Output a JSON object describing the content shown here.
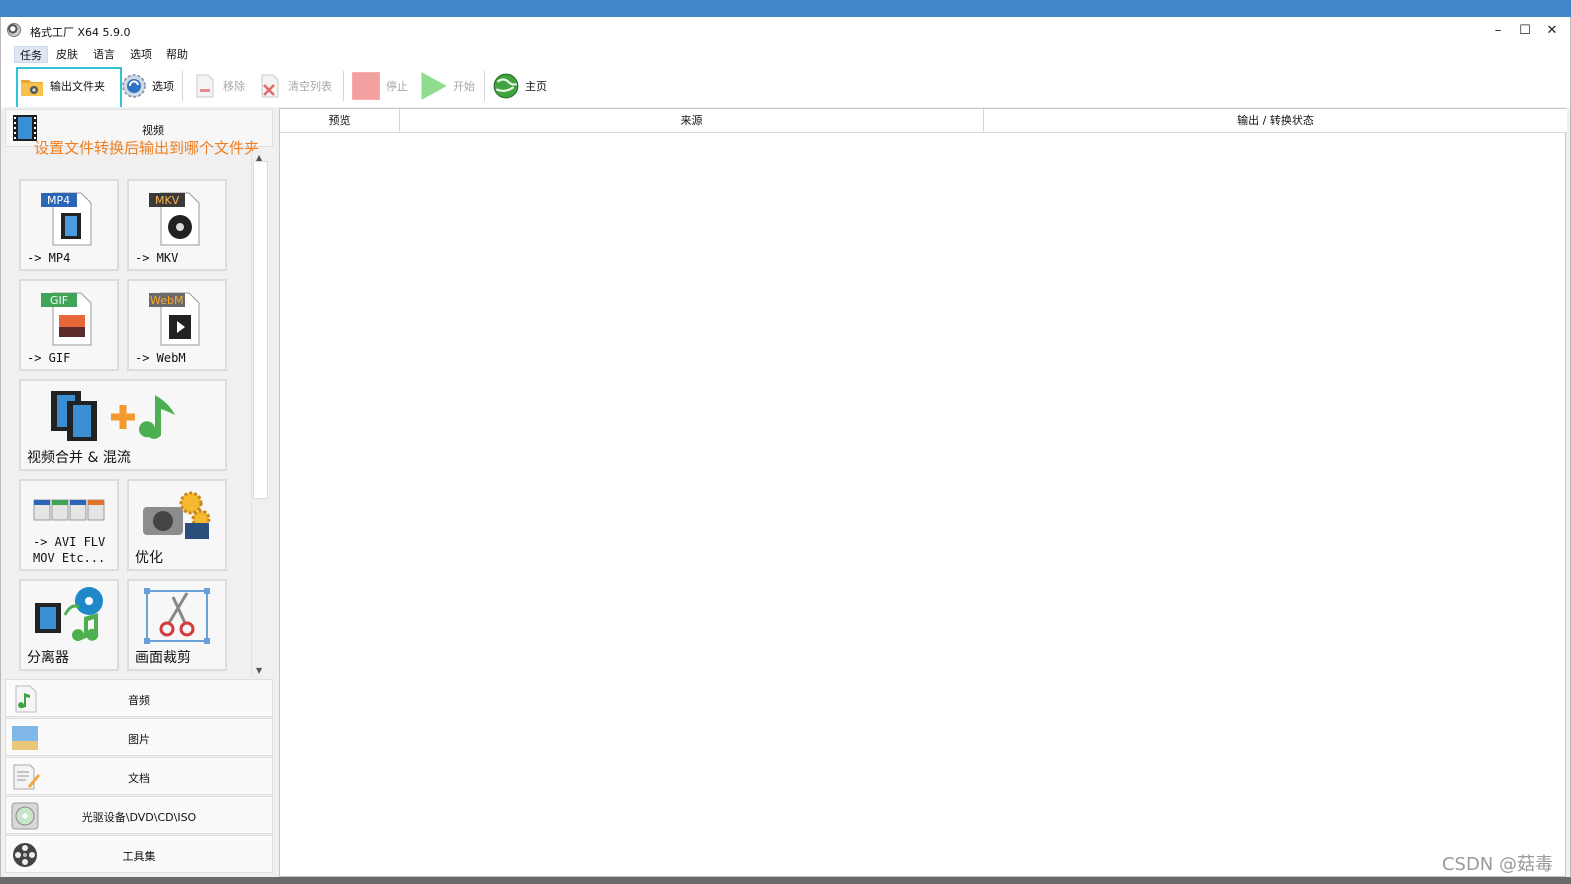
{
  "window": {
    "title": "格式工厂 X64 5.9.0"
  },
  "menu": [
    "任务",
    "皮肤",
    "语言",
    "选项",
    "帮助"
  ],
  "toolbar": {
    "output_folder": "输出文件夹",
    "options": "选项",
    "remove": "移除",
    "clear_list": "清空列表",
    "stop": "停止",
    "start": "开始",
    "home": "主页"
  },
  "annotation": "设置文件转换后输出到哪个文件夹",
  "video_category": "视频",
  "tiles": {
    "mp4_badge": "MP4",
    "mp4": "-> MP4",
    "mkv_badge": "MKV",
    "mkv": "-> MKV",
    "gif_badge": "GIF",
    "gif": "-> GIF",
    "webm_badge": "WebM",
    "webm": "-> WebM",
    "merge": "视频合并 & 混流",
    "avi_line1": "-> AVI FLV",
    "avi_line2": "MOV Etc...",
    "optimize": "优化",
    "splitter": "分离器",
    "crop": "画面裁剪"
  },
  "categories": [
    "音频",
    "图片",
    "文档",
    "光驱设备\\DVD\\CD\\ISO",
    "工具集"
  ],
  "columns": [
    "预览",
    "来源",
    "输出 / 转换状态"
  ],
  "watermark": "CSDN @菇毒",
  "colors": {
    "titlebar_blue": "#3f87c7",
    "highlight": "#2ec4d6",
    "annotation": "#ef7f22"
  }
}
